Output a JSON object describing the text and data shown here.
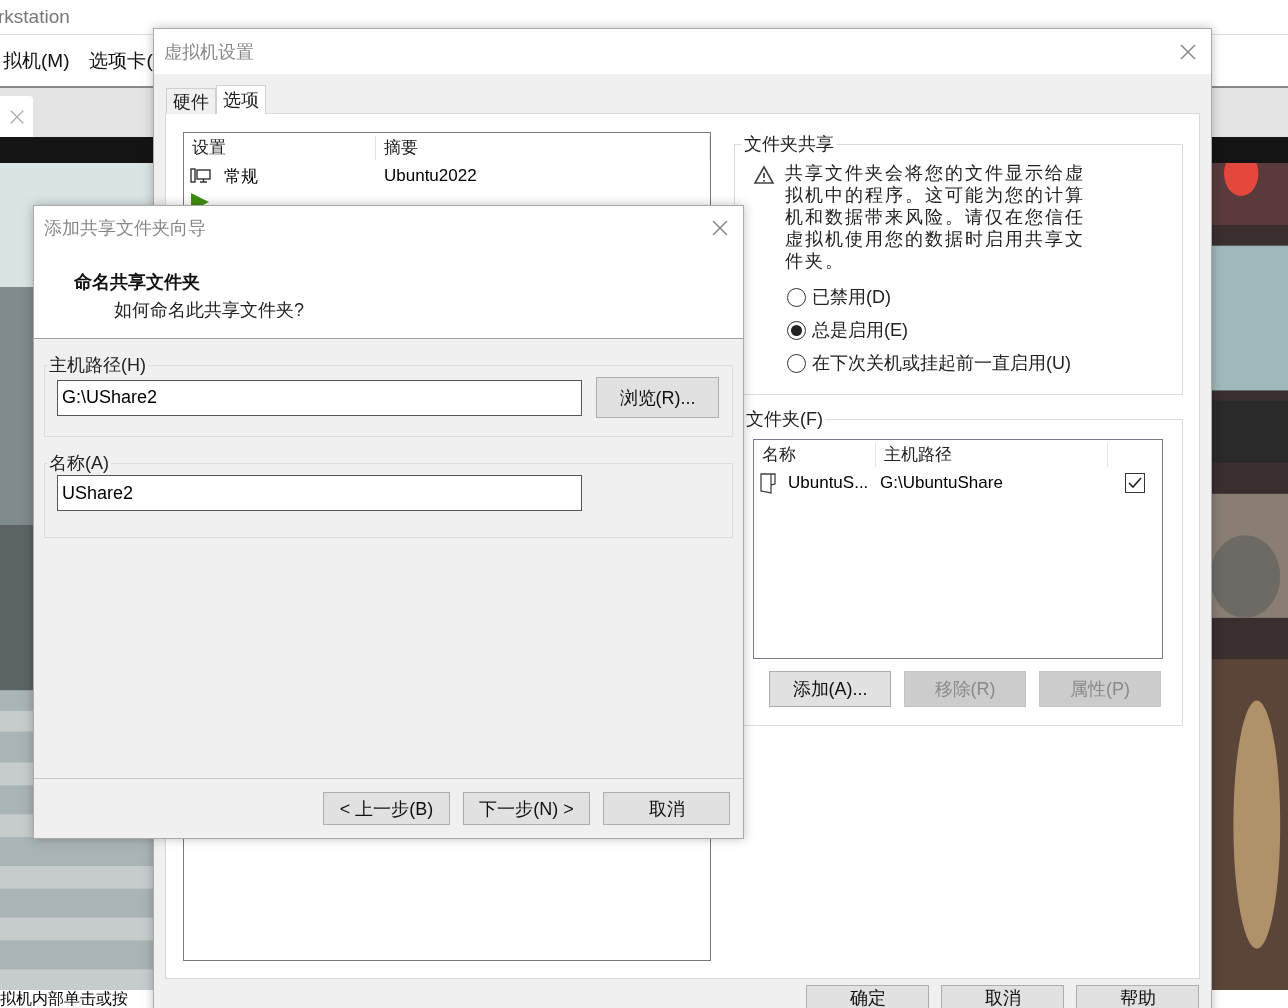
{
  "app_window": {
    "title": "rkstation",
    "menu": [
      "拟机(M)",
      "选项卡("
    ],
    "status_text": "拟机内部单击或按"
  },
  "settings_dialog": {
    "title": "虚拟机设置",
    "tabs": [
      {
        "label": "硬件",
        "selected": false
      },
      {
        "label": "选项",
        "selected": true
      }
    ],
    "settings_list": {
      "columns": [
        "设置",
        "摘要"
      ],
      "rows": [
        {
          "kind": "general",
          "name": "常规",
          "summary": "Ubuntu2022"
        },
        {
          "kind": "power"
        }
      ]
    },
    "sharing": {
      "title": "文件夹共享",
      "warning": "共享文件夹会将您的文件显示给虚拟机中的程序。这可能为您的计算机和数据带来风险。请仅在您信任虚拟机使用您的数据时启用共享文件夹。",
      "options": [
        {
          "label": "已禁用(D)",
          "selected": false
        },
        {
          "label": "总是启用(E)",
          "selected": true
        },
        {
          "label": "在下次关机或挂起前一直启用(U)",
          "selected": false
        }
      ]
    },
    "folders": {
      "title": "文件夹(F)",
      "columns": [
        "名称",
        "主机路径"
      ],
      "rows": [
        {
          "name": "UbuntuS...",
          "path": "G:\\UbuntuShare",
          "checked": true
        }
      ],
      "buttons": [
        {
          "label": "添加(A)...",
          "disabled": false
        },
        {
          "label": "移除(R)",
          "disabled": true
        },
        {
          "label": "属性(P)",
          "disabled": true
        }
      ]
    },
    "buttons": [
      "确定",
      "取消",
      "帮助"
    ]
  },
  "wizard": {
    "title": "添加共享文件夹向导",
    "heading": "命名共享文件夹",
    "subheading": "如何命名此共享文件夹?",
    "host_path": {
      "label": "主机路径(H)",
      "value": "G:\\UShare2",
      "browse": "浏览(R)..."
    },
    "name": {
      "label": "名称(A)",
      "value": "UShare2"
    },
    "buttons": [
      "< 上一步(B)",
      "下一步(N) >",
      "取消"
    ]
  }
}
